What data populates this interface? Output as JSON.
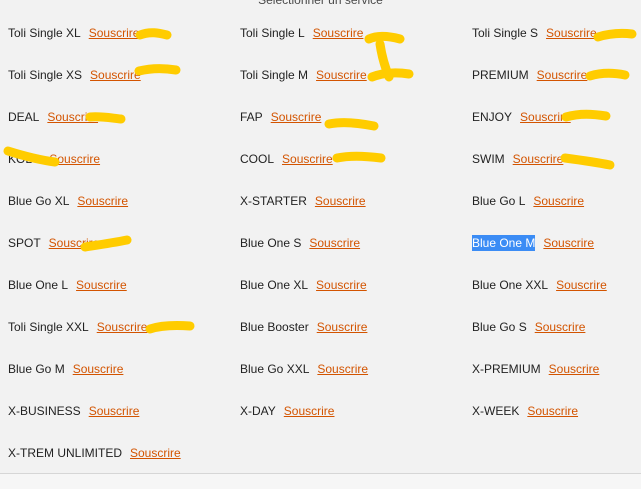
{
  "header": {
    "title": "Sélectionner un service"
  },
  "services": [
    {
      "name": "Toli Single XL",
      "action": "Souscrire",
      "selected": false
    },
    {
      "name": "Toli Single L",
      "action": "Souscrire",
      "selected": false
    },
    {
      "name": "Toli Single S",
      "action": "Souscrire",
      "selected": false
    },
    {
      "name": "Toli Single XS",
      "action": "Souscrire",
      "selected": false
    },
    {
      "name": "Toli Single M",
      "action": "Souscrire",
      "selected": false
    },
    {
      "name": "PREMIUM",
      "action": "Souscrire",
      "selected": false
    },
    {
      "name": "DEAL",
      "action": "Souscrire",
      "selected": false
    },
    {
      "name": "FAP",
      "action": "Souscrire",
      "selected": false
    },
    {
      "name": "ENJOY",
      "action": "Souscrire",
      "selected": false
    },
    {
      "name": "KOLO",
      "action": "Souscrire",
      "selected": false
    },
    {
      "name": "COOL",
      "action": "Souscrire",
      "selected": false
    },
    {
      "name": "SWIM",
      "action": "Souscrire",
      "selected": false
    },
    {
      "name": "Blue Go XL",
      "action": "Souscrire",
      "selected": false
    },
    {
      "name": "X-STARTER",
      "action": "Souscrire",
      "selected": false
    },
    {
      "name": "Blue Go L",
      "action": "Souscrire",
      "selected": false
    },
    {
      "name": "SPOT",
      "action": "Souscrire",
      "selected": false
    },
    {
      "name": "Blue One S",
      "action": "Souscrire",
      "selected": false
    },
    {
      "name": "Blue One M",
      "action": "Souscrire",
      "selected": true
    },
    {
      "name": "Blue One L",
      "action": "Souscrire",
      "selected": false
    },
    {
      "name": "Blue One XL",
      "action": "Souscrire",
      "selected": false
    },
    {
      "name": "Blue One XXL",
      "action": "Souscrire",
      "selected": false
    },
    {
      "name": "Toli Single XXL",
      "action": "Souscrire",
      "selected": false
    },
    {
      "name": "Blue Booster",
      "action": "Souscrire",
      "selected": false
    },
    {
      "name": "Blue Go S",
      "action": "Souscrire",
      "selected": false
    },
    {
      "name": "Blue Go M",
      "action": "Souscrire",
      "selected": false
    },
    {
      "name": "Blue Go XXL",
      "action": "Souscrire",
      "selected": false
    },
    {
      "name": "X-PREMIUM",
      "action": "Souscrire",
      "selected": false
    },
    {
      "name": "X-BUSINESS",
      "action": "Souscrire",
      "selected": false
    },
    {
      "name": "X-DAY",
      "action": "Souscrire",
      "selected": false
    },
    {
      "name": "X-WEEK",
      "action": "Souscrire",
      "selected": false
    },
    {
      "name": "X-TREM UNLIMITED",
      "action": "Souscrire",
      "selected": false
    }
  ],
  "colors": {
    "link": "#d35400",
    "selection": "#3b8cf5",
    "marker": "#ffcc00",
    "background": "#f2f2f2"
  }
}
